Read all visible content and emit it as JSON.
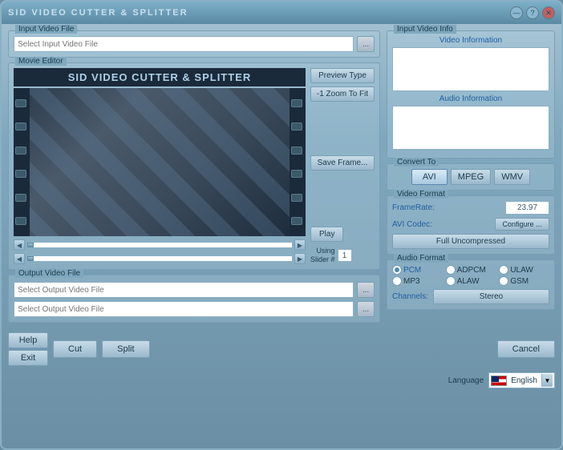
{
  "window": {
    "title": "SID  VIDEO CUTTER & SPLITTER",
    "buttons": {
      "minimize": "—",
      "help": "?",
      "close": "✕"
    }
  },
  "input_video": {
    "label": "Input Video File",
    "placeholder": "Select Input Video File",
    "browse": "..."
  },
  "movie_editor": {
    "label": "Movie Editor",
    "title": "SID VIDEO CUTTER & SPLITTER",
    "preview_type": "Preview Type",
    "zoom_to_fit": "-1 Zoom To Fit",
    "save_frame": "Save Frame...",
    "play": "Play",
    "using_slider": "Using\nSlider #",
    "slider_num": "1"
  },
  "output_video": {
    "label": "Output Video File",
    "placeholder1": "Select Output Video File",
    "placeholder2": "Select Output Video File",
    "browse1": "...",
    "browse2": "..."
  },
  "bottom_buttons": {
    "help": "Help",
    "exit": "Exit",
    "cut": "Cut",
    "split": "Split",
    "cancel": "Cancel"
  },
  "input_video_info": {
    "label": "Input Video Info",
    "video_title": "Video Information",
    "audio_title": "Audio Information"
  },
  "convert_to": {
    "label": "Convert To",
    "avi": "AVI",
    "mpeg": "MPEG",
    "wmv": "WMV"
  },
  "video_format": {
    "label": "Video Format",
    "framerate_key": "FrameRate:",
    "framerate_value": "23.97",
    "avi_codec_key": "AVI Codec:",
    "configure_btn": "Configure ...",
    "full_uncomp": "Full Uncompressed"
  },
  "audio_format": {
    "label": "Audio Format",
    "pcm": "PCM",
    "adpcm": "ADPCM",
    "ulaw": "ULAW",
    "mp3": "MP3",
    "alaw": "ALAW",
    "gsm": "GSM",
    "channels_label": "Channels:",
    "stereo_btn": "Stereo"
  },
  "language": {
    "label": "Language",
    "selected": "English"
  }
}
